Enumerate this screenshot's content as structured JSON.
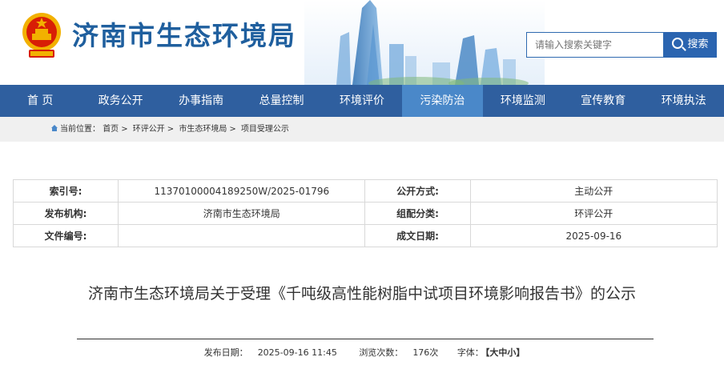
{
  "site": {
    "title": "济南市生态环境局",
    "emblem_icon": "national-emblem-icon",
    "brand_color": "#1f5f9e"
  },
  "search": {
    "placeholder": "请输入搜索关键字",
    "button_label": "搜索",
    "icon": "search-icon"
  },
  "nav": {
    "items": [
      {
        "label": "首 页"
      },
      {
        "label": "政务公开"
      },
      {
        "label": "办事指南"
      },
      {
        "label": "总量控制"
      },
      {
        "label": "环境评价"
      },
      {
        "label": "污染防治"
      },
      {
        "label": "环境监测"
      },
      {
        "label": "宣传教育"
      },
      {
        "label": "环境执法"
      }
    ],
    "active_index": 5,
    "color": "#2f5f9f",
    "active_color": "#4a88c9"
  },
  "breadcrumb": {
    "prefix": "当前位置：",
    "items": [
      "首页",
      "环评公开",
      "市生态环境局",
      "项目受理公示"
    ],
    "separator": ">"
  },
  "info": {
    "index_label": "索引号:",
    "index_value": "11370100004189250W/2025-01796",
    "public_mode_label": "公开方式:",
    "public_mode_value": "主动公开",
    "publisher_label": "发布机构:",
    "publisher_value": "济南市生态环境局",
    "category_label": "组配分类:",
    "category_value": "环评公开",
    "doc_no_label": "文件编号:",
    "doc_no_value": "",
    "date_label": "成文日期:",
    "date_value": "2025-09-16"
  },
  "article": {
    "title": "济南市生态环境局关于受理《千吨级高性能树脂中试项目环境影响报告书》的公示",
    "publish_date_label": "发布日期：",
    "publish_date": "2025-09-16 11:45",
    "views_label": "浏览次数：",
    "views": "176次",
    "font_label": "字体：",
    "font_open": "【",
    "font_large": "大",
    "font_medium": "中",
    "font_small": "小",
    "font_close": "】"
  }
}
